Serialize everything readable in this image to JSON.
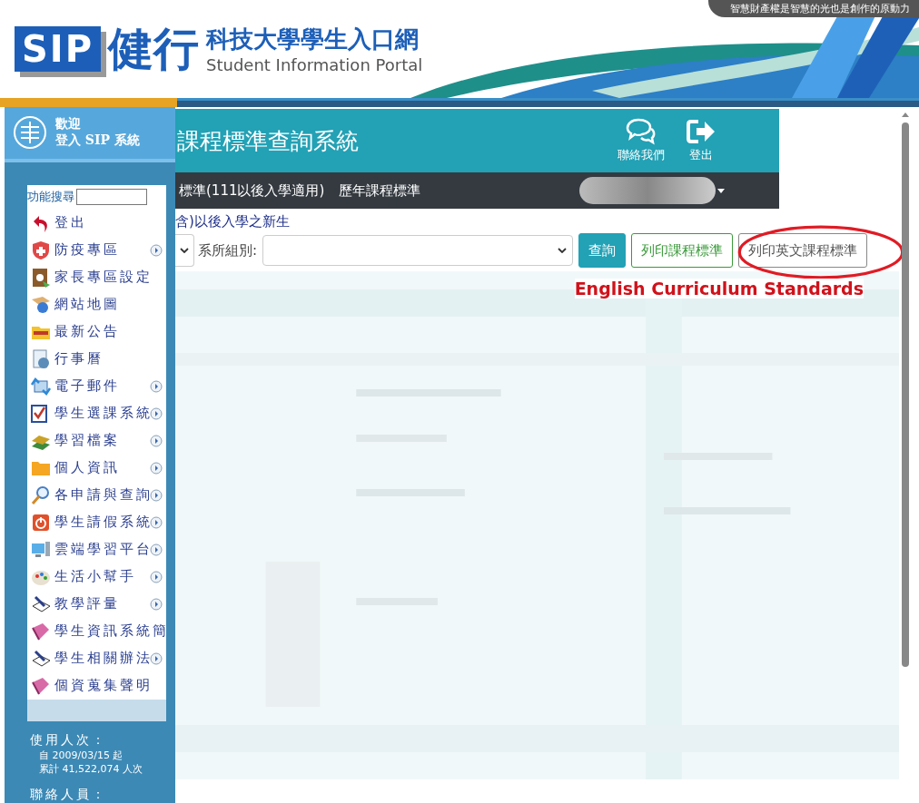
{
  "header": {
    "logo": "SIP",
    "school_name": "健行",
    "portal_title": "科技大學學生入口網",
    "subtitle": "Student Information Portal",
    "tagline": "智慧財產權是智慧的光也是創作的原動力"
  },
  "sidebar": {
    "welcome": "歡迎",
    "login_text": "登入 SIP 系統",
    "search": {
      "label": "功能搜尋"
    },
    "items": [
      {
        "label": "登出",
        "submenu": false
      },
      {
        "label": "防疫專區",
        "submenu": true
      },
      {
        "label": "家長專區設定",
        "submenu": false
      },
      {
        "label": "網站地圖",
        "submenu": false
      },
      {
        "label": "最新公告",
        "submenu": false
      },
      {
        "label": "行事曆",
        "submenu": false
      },
      {
        "label": "電子郵件",
        "submenu": true
      },
      {
        "label": "學生選課系統",
        "submenu": true
      },
      {
        "label": "學習檔案",
        "submenu": true
      },
      {
        "label": "個人資訊",
        "submenu": true
      },
      {
        "label": "各申請與查詢",
        "submenu": true
      },
      {
        "label": "學生請假系統",
        "submenu": true
      },
      {
        "label": "雲端學習平台",
        "submenu": true
      },
      {
        "label": "生活小幫手",
        "submenu": true
      },
      {
        "label": "教學評量",
        "submenu": true
      },
      {
        "label": "學生資訊系統簡",
        "submenu": false
      },
      {
        "label": "學生相關辦法",
        "submenu": true
      },
      {
        "label": "個資蒐集聲明",
        "submenu": false
      }
    ],
    "stats": {
      "usage_label": "使用人次：",
      "since": "自 2009/03/15 起",
      "total": "累計 41,522,074 人次",
      "contact_label": "聯絡人員："
    }
  },
  "main": {
    "title": "課程標準查詢系統",
    "actions": [
      {
        "kind": "chat",
        "label": "聯絡我們"
      },
      {
        "kind": "logout",
        "label": "登出"
      }
    ],
    "nav": [
      "標準(111以後入學適用)",
      "歷年課程標準"
    ],
    "notice": "含)以後入學之新生",
    "filter": {
      "label": "系所組別:"
    },
    "buttons": [
      {
        "kind": "primary",
        "label": "查詢"
      },
      {
        "kind": "green",
        "label": "列印課程標準"
      },
      {
        "kind": "grey",
        "label": "列印英文課程標準"
      }
    ],
    "annotation": "English Curriculum Standards"
  }
}
